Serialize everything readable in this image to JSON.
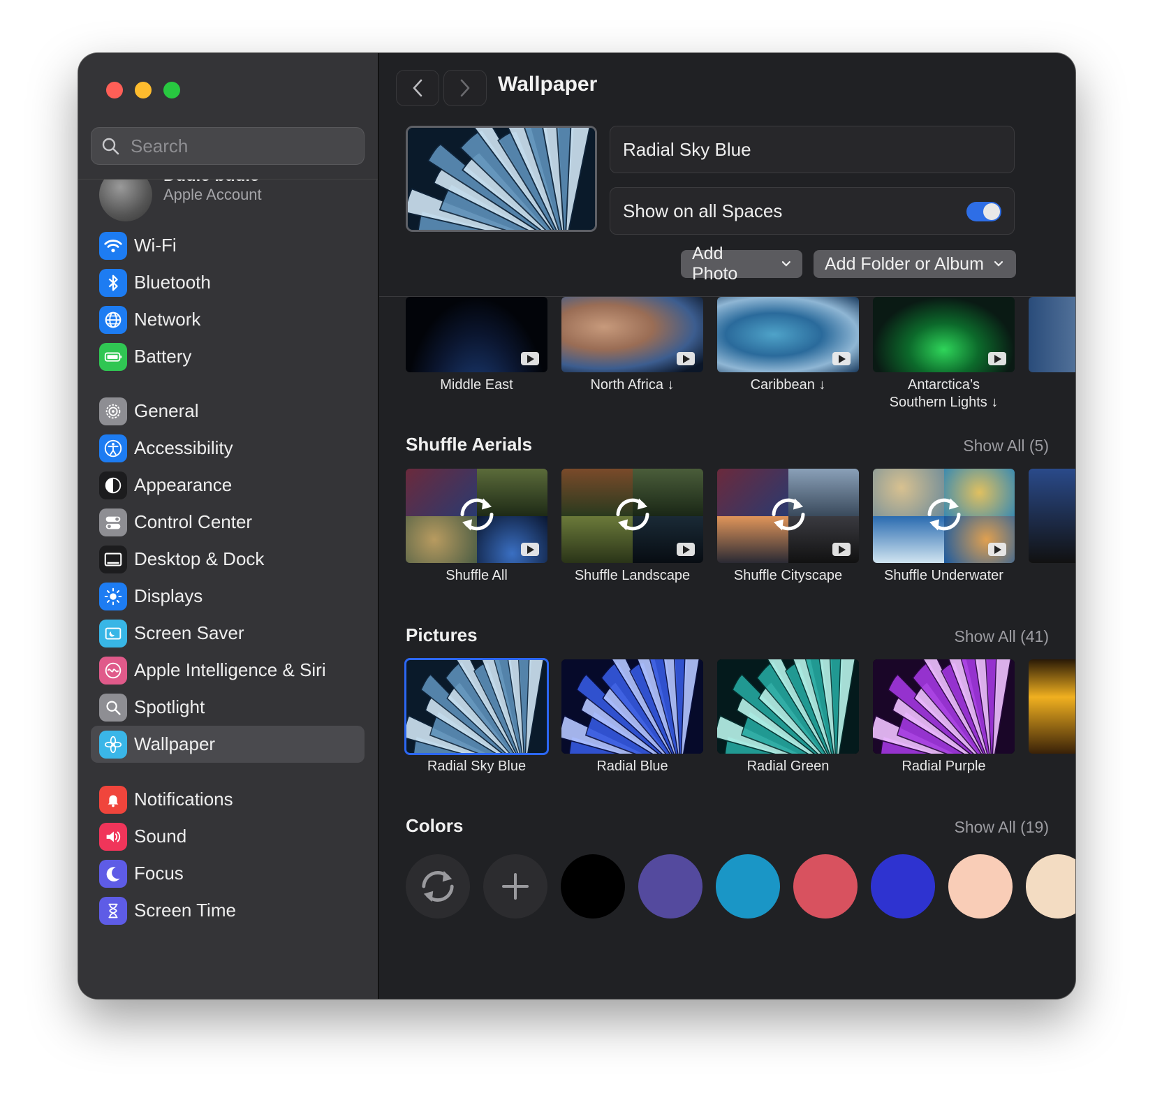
{
  "sidebar": {
    "search_placeholder": "Search",
    "account": {
      "name": "Dudie budie",
      "subtitle": "Apple Account"
    },
    "groups": [
      [
        {
          "label": "Wi-Fi",
          "icon": "wifi-icon",
          "color": "#1d7cf2"
        },
        {
          "label": "Bluetooth",
          "icon": "bluetooth-icon",
          "color": "#1d7cf2"
        },
        {
          "label": "Network",
          "icon": "globe-icon",
          "color": "#1d7cf2"
        },
        {
          "label": "Battery",
          "icon": "battery-icon",
          "color": "#30c653"
        }
      ],
      [
        {
          "label": "General",
          "icon": "gear-icon",
          "color": "#8e8e93"
        },
        {
          "label": "Accessibility",
          "icon": "accessibility-icon",
          "color": "#1d7cf2"
        },
        {
          "label": "Appearance",
          "icon": "appearance-icon",
          "color": "#1c1c1e"
        },
        {
          "label": "Control Center",
          "icon": "control-center-icon",
          "color": "#8e8e93"
        },
        {
          "label": "Desktop & Dock",
          "icon": "dock-icon",
          "color": "#1c1c1e"
        },
        {
          "label": "Displays",
          "icon": "sun-icon",
          "color": "#1d7cf2"
        },
        {
          "label": "Screen Saver",
          "icon": "screen-saver-icon",
          "color": "#38b6e6"
        },
        {
          "label": "Apple Intelligence & Siri",
          "icon": "siri-icon",
          "color": "#e05a8a"
        },
        {
          "label": "Spotlight",
          "icon": "magnifier-icon",
          "color": "#8e8e93"
        },
        {
          "label": "Wallpaper",
          "icon": "wallpaper-icon",
          "color": "#3ab6e8",
          "selected": true
        }
      ],
      [
        {
          "label": "Notifications",
          "icon": "bell-icon",
          "color": "#f0453c"
        },
        {
          "label": "Sound",
          "icon": "speaker-icon",
          "color": "#f0355a"
        },
        {
          "label": "Focus",
          "icon": "moon-icon",
          "color": "#5e5ce6"
        },
        {
          "label": "Screen Time",
          "icon": "hourglass-icon",
          "color": "#5e5ce6"
        }
      ]
    ]
  },
  "header": {
    "title": "Wallpaper"
  },
  "current": {
    "name": "Radial Sky Blue",
    "show_all_spaces_label": "Show on all Spaces",
    "show_all_spaces": true,
    "add_photo_label": "Add Photo",
    "add_folder_label": "Add Folder or Album"
  },
  "landscapes": [
    {
      "label": "Middle East",
      "download": false
    },
    {
      "label": "North Africa ↓",
      "download": true
    },
    {
      "label": "Caribbean ↓",
      "download": true
    },
    {
      "label": "Antarctica’s\nSouthern Lights ↓",
      "download": true
    }
  ],
  "shuffle_section": {
    "title": "Shuffle Aerials",
    "show_all": "Show All (5)",
    "items": [
      "Shuffle All",
      "Shuffle Landscape",
      "Shuffle Cityscape",
      "Shuffle Underwater"
    ]
  },
  "pictures_section": {
    "title": "Pictures",
    "show_all": "Show All (41)",
    "items": [
      {
        "label": "Radial Sky Blue",
        "selected": true
      },
      {
        "label": "Radial Blue"
      },
      {
        "label": "Radial Green"
      },
      {
        "label": "Radial Purple"
      }
    ]
  },
  "colors_section": {
    "title": "Colors",
    "show_all": "Show All (19)",
    "swatches": [
      "#000000",
      "#544a9e",
      "#1a96c6",
      "#d8525f",
      "#2e33d0",
      "#f9cdb7"
    ],
    "partial_swatch": "#f3dcc2"
  },
  "accent_color": "#2c67f2"
}
